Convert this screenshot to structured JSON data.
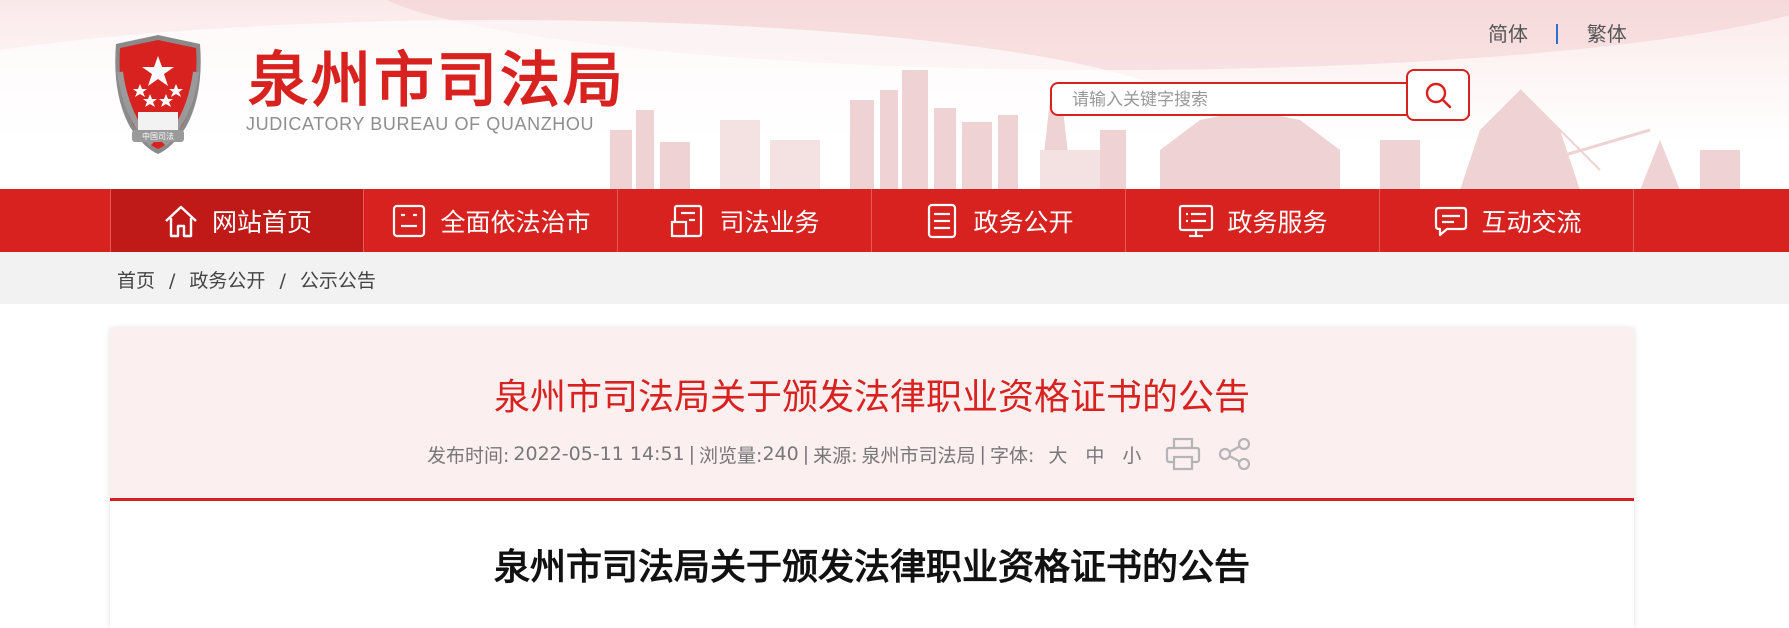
{
  "header": {
    "title": "泉州市司法局",
    "subtitle": "JUDICATORY BUREAU OF QUANZHOU",
    "emblem_text": "中国司法",
    "lang": [
      "简体",
      "繁体"
    ],
    "search_placeholder": "请输入关键字搜索"
  },
  "nav": {
    "items": [
      {
        "label": "网站首页",
        "icon": "home-icon",
        "active": true
      },
      {
        "label": "全面依法治市",
        "icon": "law-icon"
      },
      {
        "label": "司法业务",
        "icon": "business-icon"
      },
      {
        "label": "政务公开",
        "icon": "document-icon"
      },
      {
        "label": "政务服务",
        "icon": "service-icon"
      },
      {
        "label": "互动交流",
        "icon": "chat-icon"
      }
    ]
  },
  "breadcrumb": [
    "首页",
    "政务公开",
    "公示公告"
  ],
  "article": {
    "title": "泉州市司法局关于颁发法律职业资格证书的公告",
    "meta": {
      "publish_label": "发布时间:",
      "publish_time": "2022-05-11 14:51",
      "views_label": "浏览量:",
      "views": "240",
      "source_label": "来源:",
      "source": "泉州市司法局",
      "font_label": "字体:",
      "font_sizes": [
        "大",
        "中",
        "小"
      ]
    },
    "body_title": "泉州市司法局关于颁发法律职业资格证书的公告"
  },
  "colors": {
    "brand": "#d7221f",
    "nav_active": "#bf1a18",
    "header_bg": "#fcefef"
  }
}
